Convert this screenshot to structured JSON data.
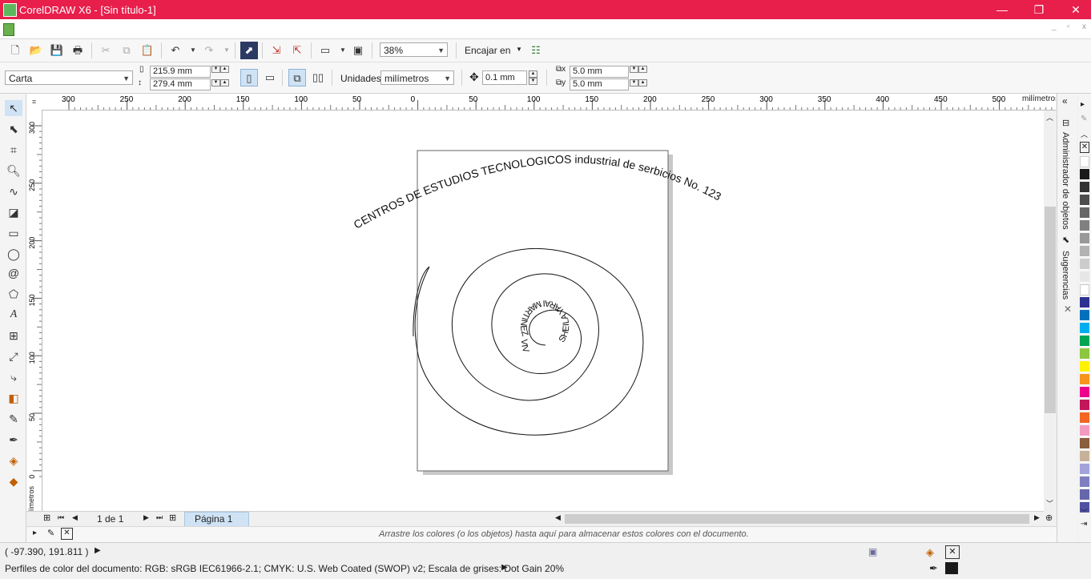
{
  "window": {
    "title": "CorelDRAW X6 - [Sin título-1]",
    "minimize_glyph": "—",
    "restore_glyph": "❐",
    "close_glyph": "✕",
    "doc_minimize": "_",
    "doc_restore": "▫",
    "doc_close": "x"
  },
  "toolbar": {
    "zoom_value": "38%",
    "snap_label": "Encajar en"
  },
  "propbar": {
    "page_size": "Carta",
    "width": "215.9 mm",
    "height": "279.4 mm",
    "units_label": "Unidades:",
    "units_value": "milímetros",
    "nudge": "0.1 mm",
    "dup_x": "5.0 mm",
    "dup_y": "5.0 mm"
  },
  "ruler": {
    "h_unit": "milímetros",
    "v_unit": "milímetros",
    "h_ticks": [
      "300",
      "250",
      "200",
      "150",
      "100",
      "50",
      "0",
      "50",
      "100",
      "150",
      "200",
      "250",
      "300",
      "350",
      "400",
      "450",
      "500"
    ],
    "v_ticks": [
      "300",
      "250",
      "200",
      "150",
      "100",
      "50",
      "0"
    ]
  },
  "drawing": {
    "arc_text": "CENTROS DE ESTUDIOS TECNOLOGICOS industrial de serbicios No. 123",
    "spiral_text": "SHEILA YARAI MARTINEZ VIVEROS"
  },
  "pages": {
    "counter": "1 de 1",
    "tab": "Página 1"
  },
  "doc_palette_hint": "Arrastre los colores (o los objetos) hasta aquí para almacenar estos colores con el documento.",
  "dock": {
    "objects_manager": "Administrador de objetos",
    "hints": "Sugerencias"
  },
  "status": {
    "coords": "( -97.390, 191.811 )",
    "color_profiles": "Perfiles de color del documento: RGB: sRGB IEC61966-2.1; CMYK: U.S. Web Coated (SWOP) v2; Escala de grises: Dot Gain 20%"
  },
  "palette_colors": [
    "#ffffff",
    "#1a1a1a",
    "#333333",
    "#4d4d4d",
    "#666666",
    "#808080",
    "#999999",
    "#b3b3b3",
    "#cccccc",
    "#e6e6e6",
    "#ffffff",
    "#2e3192",
    "#0072bc",
    "#00aeef",
    "#00a651",
    "#8dc63f",
    "#fff200",
    "#f7941d",
    "#ec008c",
    "#c2185b",
    "#f26522",
    "#f49ac1",
    "#8b5e3c",
    "#c7b299",
    "#a3a3d9",
    "#7f7fbf",
    "#6666aa",
    "#5252a3"
  ]
}
